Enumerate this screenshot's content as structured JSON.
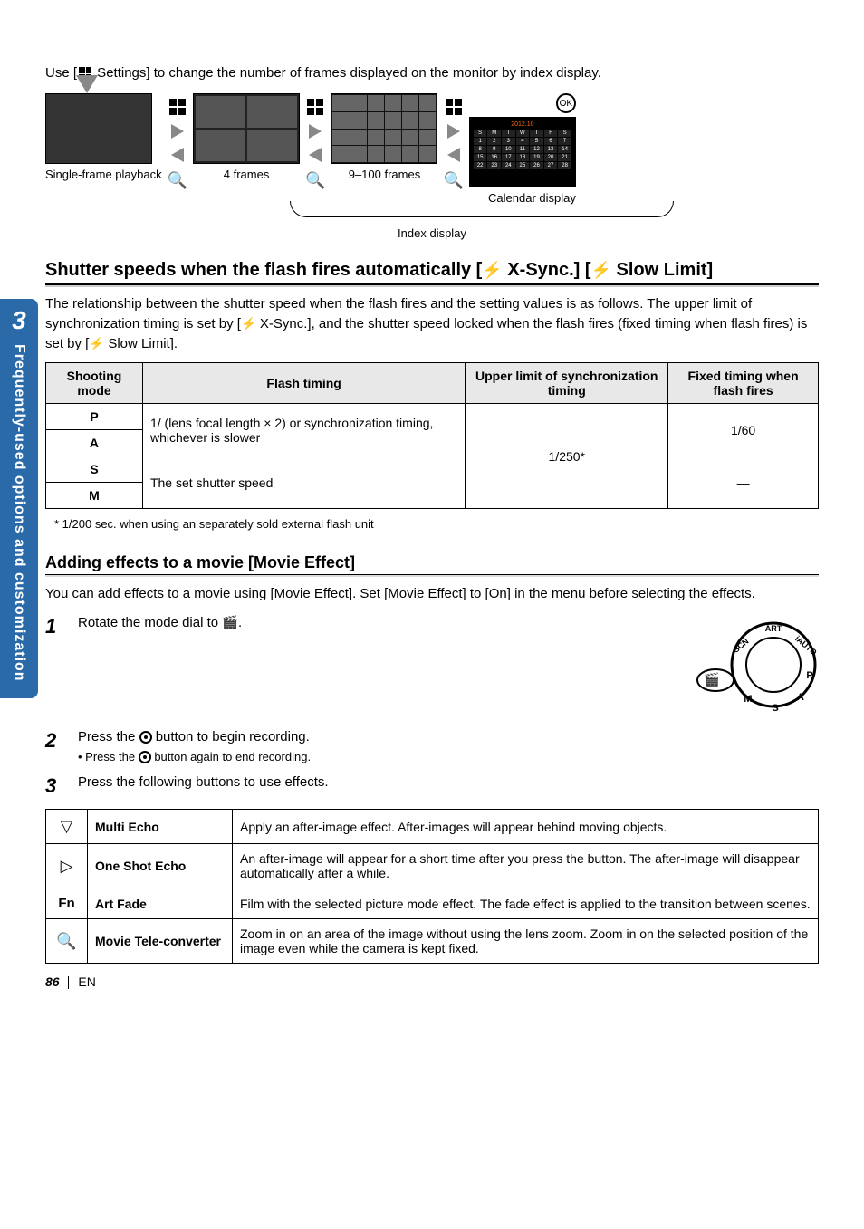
{
  "intro": "Use [■ Settings] to change the number of frames displayed on the monitor by index display.",
  "diagram": {
    "single": "Single-frame playback",
    "four": "4 frames",
    "many": "9–100 frames",
    "cal": "Calendar display",
    "index": "Index display",
    "ok": "OK",
    "cal_month": "2012.10",
    "days": [
      "Sun",
      "Mon",
      "Tue",
      "Wed",
      "Thu",
      "Fri",
      "Sat"
    ]
  },
  "sidetab": {
    "num": "3",
    "text": "Frequently-used options and customization"
  },
  "section1": {
    "title_pre": "Shutter speeds when the flash fires automatically [",
    "title_mid": " X-Sync.] [",
    "title_post": " Slow Limit]",
    "body_1": "The relationship between the shutter speed when the flash fires and the setting values is as follows. The upper limit of synchronization timing is set by [",
    "body_2": " X-Sync.], and the shutter speed locked when the flash fires (fixed timing when flash fires) is set by [",
    "body_3": " Slow Limit]."
  },
  "table1": {
    "h1": "Shooting mode",
    "h2": "Flash timing",
    "h3": "Upper limit of synchronization timing",
    "h4": "Fixed timing when flash fires",
    "r_p": "P",
    "r_a": "A",
    "r_s": "S",
    "r_m": "M",
    "cell_pa": "1/ (lens focal length × 2) or synchronization timing, whichever is slower",
    "cell_sm": "The set shutter speed",
    "upper": "1/250*",
    "fixed_pa": "1/60",
    "fixed_sm": "—"
  },
  "footnote": "*  1/200 sec. when using an separately sold external flash unit",
  "section2": {
    "title": "Adding effects to a movie [Movie Effect]",
    "body": "You can add effects to a movie using [Movie Effect]. Set [Movie Effect] to [On] in the menu before selecting the effects."
  },
  "steps": {
    "s1": "Rotate the mode dial to ",
    "s2": "Press the ",
    "s2b": " button to begin recording.",
    "s2_sub_a": "Press the ",
    "s2_sub_b": " button again to end recording.",
    "s3": "Press the following buttons to use effects."
  },
  "table2": {
    "r1_name": "Multi Echo",
    "r1_desc": "Apply an after-image effect. After-images will appear behind moving objects.",
    "r2_name": "One Shot Echo",
    "r2_desc": "An after-image will appear for a short time after you press the button. The after-image will disappear automatically after a while.",
    "r3_icon": "Fn",
    "r3_name": "Art Fade",
    "r3_desc": "Film with the selected picture mode effect. The fade effect is applied to the transition between scenes.",
    "r4_name": "Movie Tele-converter",
    "r4_desc": "Zoom in on an area of the image without using the lens zoom. Zoom in on the selected position of the image even while the camera is kept fixed."
  },
  "foot": {
    "page": "86",
    "lang": "EN"
  }
}
